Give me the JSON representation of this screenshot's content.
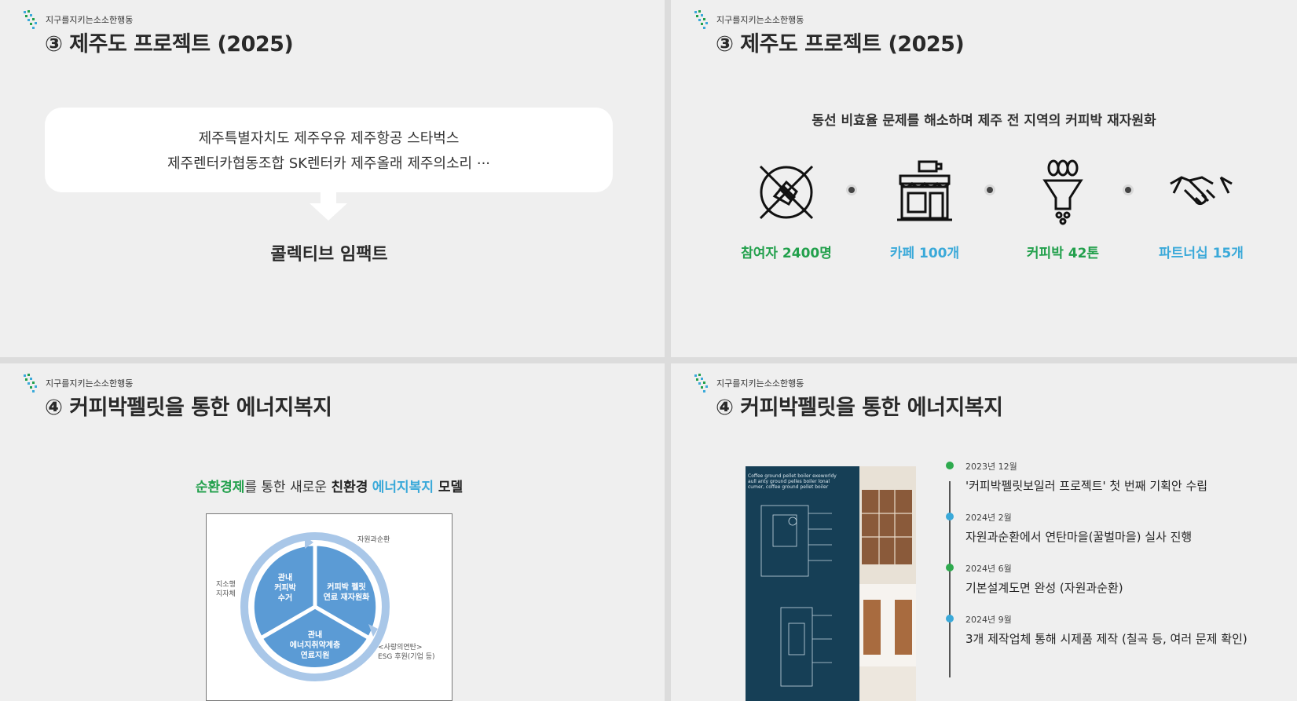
{
  "brand": "지구를지키는소소한행동",
  "slide1": {
    "title": "③ 제주도 프로젝트 (2025)",
    "partners_line1": "제주특별자치도  제주우유  제주항공  스타벅스",
    "partners_line2": "제주렌터카협동조합  SK렌터카  제주올래  제주의소리 ···",
    "result": "콜렉티브 임팩트"
  },
  "slide2": {
    "title": "③ 제주도 프로젝트 (2025)",
    "subtitle": "동선 비효율 문제를 해소하며 제주 전 지역의 커피박 재자원화",
    "metrics": [
      {
        "icon": "hands-together-icon",
        "label": "참여자 2400명",
        "color": "#22a04c"
      },
      {
        "icon": "cafe-store-icon",
        "label": "카페 100개",
        "color": "#3aa9d9"
      },
      {
        "icon": "coffee-bean-filter-icon",
        "label": "커피박 42톤",
        "color": "#22a04c"
      },
      {
        "icon": "handshake-icon",
        "label": "파트너십 15개",
        "color": "#3aa9d9"
      }
    ]
  },
  "slide3": {
    "title": "④ 커피박펠릿을 통한 에너지복지",
    "subtitle": {
      "p1": "순환경제",
      "p2": "를 통한 새로운 ",
      "p3": "친환경",
      "p4": " ",
      "p5": "에너지복지",
      "p6": " 모델"
    },
    "cycle": {
      "seg1": [
        "관내",
        "커피박",
        "수거"
      ],
      "seg2": [
        "커피박 펠릿",
        "연료 재자원화"
      ],
      "seg3": [
        "관내",
        "에너지취약계층",
        "연료지원"
      ],
      "label_top": "자원과순환",
      "label_left": [
        "지소행",
        "지자체"
      ],
      "label_right": [
        "<사랑의연탄>",
        "ESG 후원(기업 등)"
      ]
    }
  },
  "slide4": {
    "title": "④ 커피박펠릿을 통한 에너지복지",
    "blueprint_caption": [
      "Coffee ground pellet boiler exeworldy",
      "aull anty ground pelles boiler lonal",
      "cumer, coffee ground pellet boiler"
    ],
    "timeline": [
      {
        "date": "2023년 12월",
        "desc": "'커피박펠릿보일러 프로젝트' 첫 번째 기획안 수립"
      },
      {
        "date": "2024년 2월",
        "desc": "자원과순환에서 연탄마을(꿀벌마을) 실사 진행"
      },
      {
        "date": "2024년 6월",
        "desc": "기본설계도면 완성 (자원과순환)"
      },
      {
        "date": "2024년 9월",
        "desc": "3개 제작업체 통해 시제품 제작 (칠곡 등, 여러 문제 확인)"
      }
    ]
  }
}
